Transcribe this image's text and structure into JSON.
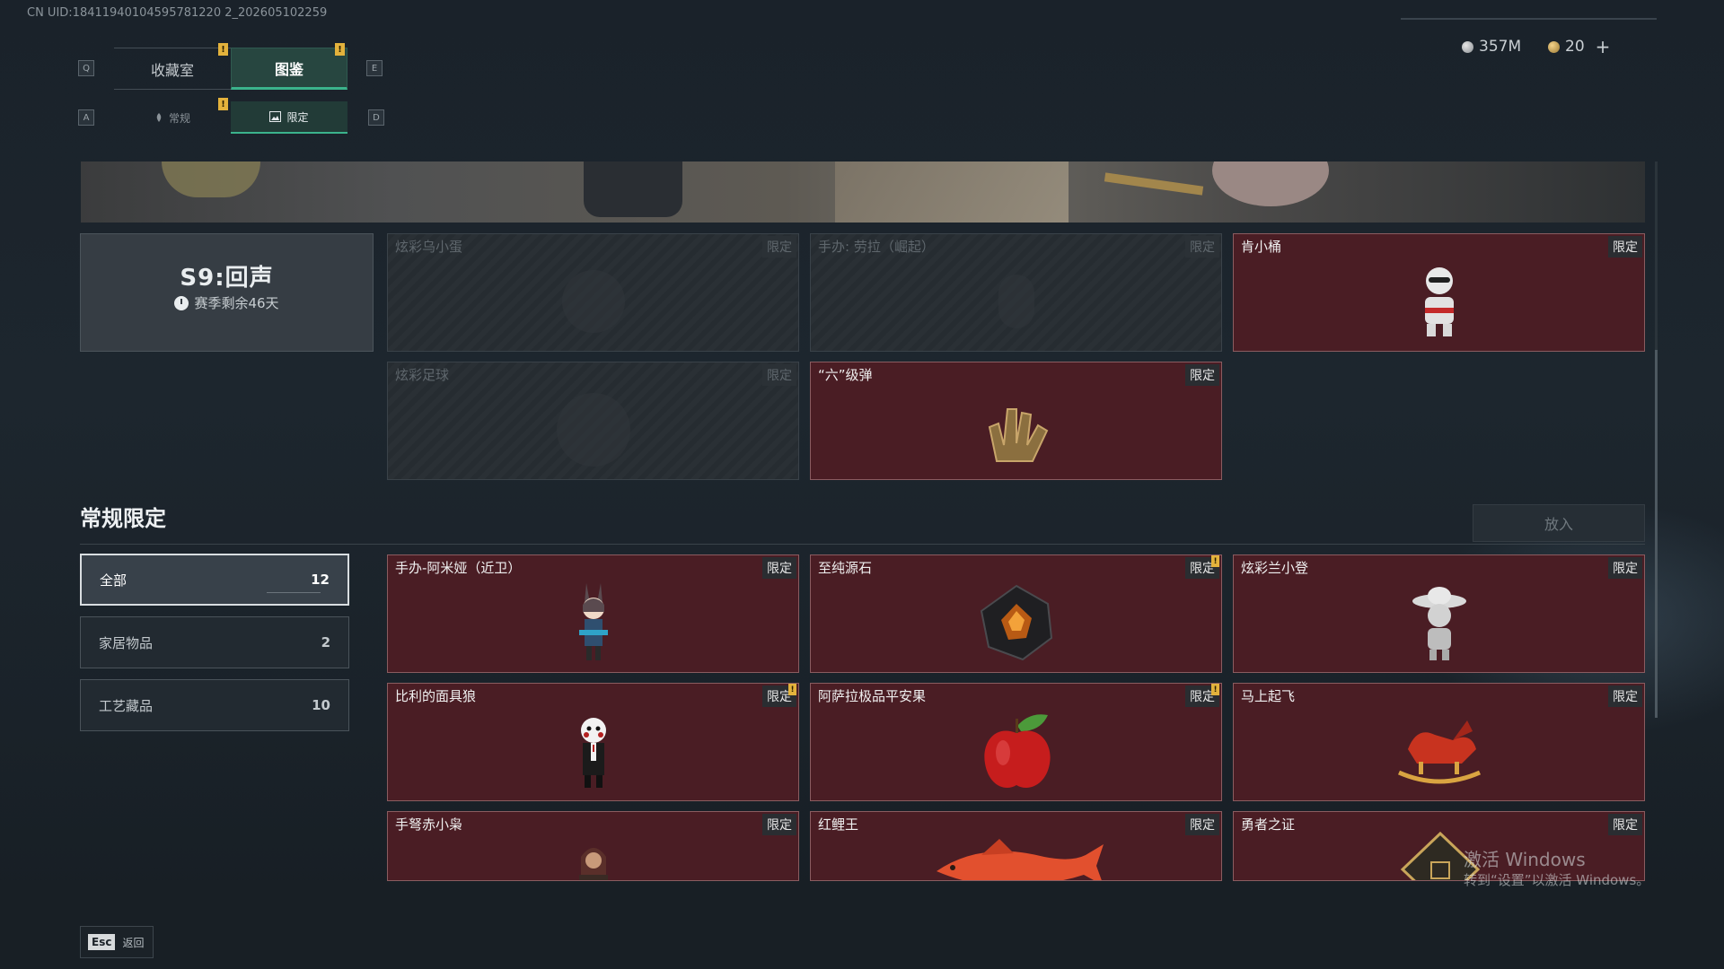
{
  "uid": "CN UID:18411940104595781220 2_202605102259",
  "currency": {
    "silver": "357M",
    "gold": "20",
    "add": "+"
  },
  "keys": {
    "q": "Q",
    "e": "E",
    "a": "A",
    "d": "D",
    "esc": "Esc"
  },
  "tabs": {
    "collection_room": "收藏室",
    "codex": "图鉴"
  },
  "subtabs": {
    "regular": "常规",
    "limited": "限定"
  },
  "notif_mark": "!",
  "season": {
    "name": "S9:回声",
    "remaining": "赛季剩余46天"
  },
  "season_items": [
    {
      "name": "炫彩乌小蛋",
      "tag": "限定",
      "owned": false
    },
    {
      "name": "手办: 劳拉（崛起）",
      "tag": "限定",
      "owned": false
    },
    {
      "name": "肯小桶",
      "tag": "限定",
      "owned": true,
      "icon": "bucket-figure-icon"
    },
    {
      "name": "炫彩足球",
      "tag": "限定",
      "owned": false
    },
    {
      "name": "“六”级弹",
      "tag": "限定",
      "owned": true,
      "icon": "bullet-hand-icon"
    }
  ],
  "section": {
    "title": "常规限定",
    "put_button": "放入"
  },
  "filters": [
    {
      "label": "全部",
      "count": "12"
    },
    {
      "label": "家居物品",
      "count": "2"
    },
    {
      "label": "工艺藏品",
      "count": "10"
    }
  ],
  "regular_items": [
    {
      "name": "手办-阿米娅（近卫）",
      "tag": "限定",
      "icon": "amiya-figure-icon"
    },
    {
      "name": "至纯源石",
      "tag": "限定",
      "icon": "originium-icon",
      "new": true
    },
    {
      "name": "炫彩兰小登",
      "tag": "限定",
      "icon": "sombrero-figure-icon"
    },
    {
      "name": "比利的面具狼",
      "tag": "限定",
      "icon": "billy-puppet-icon",
      "new": true
    },
    {
      "name": "阿萨拉极品平安果",
      "tag": "限定",
      "icon": "apple-icon",
      "new": true
    },
    {
      "name": "马上起飞",
      "tag": "限定",
      "icon": "rocking-horse-icon"
    },
    {
      "name": "手弩赤小枭",
      "tag": "限定",
      "icon": "crossbow-figure-icon"
    },
    {
      "name": "红鲤王",
      "tag": "限定",
      "icon": "red-carp-icon"
    },
    {
      "name": "勇者之证",
      "tag": "限定",
      "icon": "badge-icon"
    }
  ],
  "footer": {
    "back": "返回"
  },
  "watermark": {
    "line1": "激活 Windows",
    "line2": "转到“设置”以激活 Windows。"
  },
  "colors": {
    "accent": "#3bb38c",
    "owned_card": "#4a1d24",
    "notif": "#e3b23c"
  }
}
